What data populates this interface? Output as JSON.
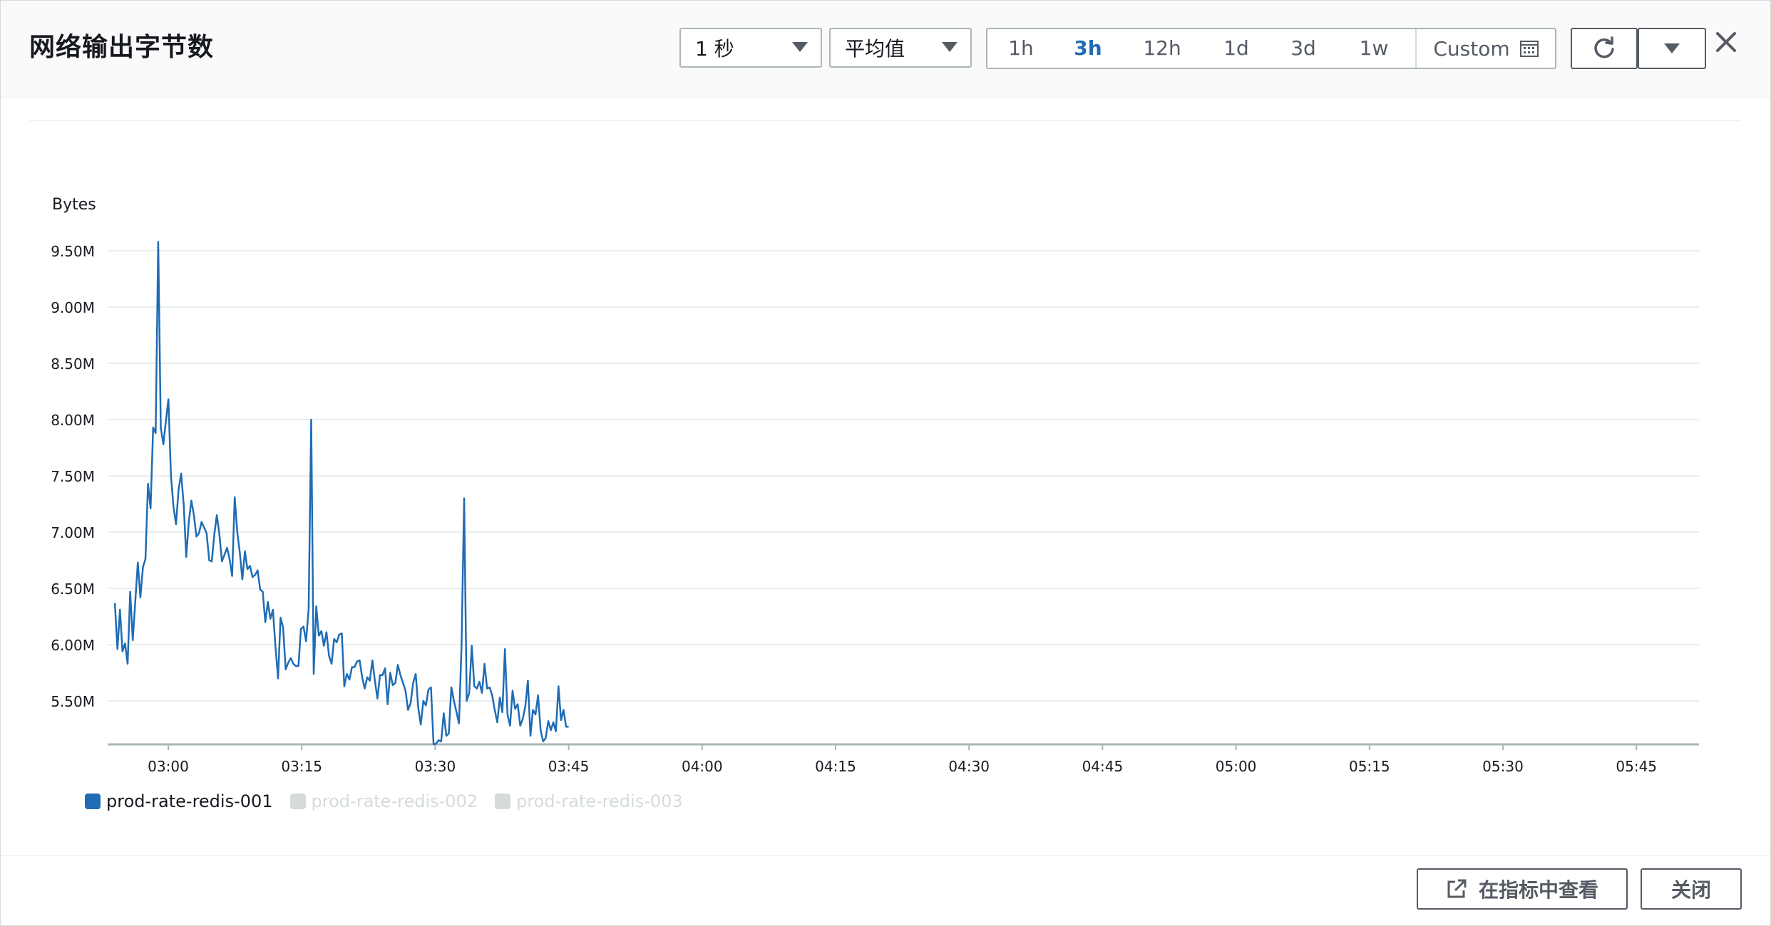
{
  "header": {
    "title": "网络输出字节数",
    "period_select": "1 秒",
    "stat_select": "平均值",
    "ranges": [
      "1h",
      "3h",
      "12h",
      "1d",
      "3d",
      "1w"
    ],
    "active_range": "3h",
    "custom_label": "Custom"
  },
  "footer": {
    "view_in_metrics": "在指标中查看",
    "close": "关闭"
  },
  "colors": {
    "series_primary": "#1f6cb5",
    "series_disabled": "#d5dbdb",
    "active_range": "#1f6cb5"
  },
  "icons": {
    "refresh": "refresh-icon",
    "dropdown": "chevron-down-icon",
    "close": "close-icon",
    "calendar": "calendar-icon",
    "external": "external-link-icon"
  },
  "chart_data": {
    "type": "line",
    "ylabel": "Bytes",
    "yticks": [
      "5.50M",
      "6.00M",
      "6.50M",
      "7.00M",
      "7.50M",
      "8.00M",
      "8.50M",
      "9.00M",
      "9.50M"
    ],
    "ylim": [
      5.2,
      9.65
    ],
    "xticks": [
      "03:00",
      "03:15",
      "03:30",
      "03:45",
      "04:00",
      "04:15",
      "04:30",
      "04:45",
      "05:00",
      "05:15",
      "05:30",
      "05:45"
    ],
    "x_range_minutes_from_0300": [
      -6,
      45
    ],
    "grid": true,
    "legend_position": "bottom-left",
    "series": [
      {
        "name": "prod-rate-redis-001",
        "enabled": true,
        "values": [
          6.37,
          5.96,
          6.31,
          5.94,
          6.01,
          5.83,
          6.47,
          6.04,
          6.38,
          6.73,
          6.42,
          6.69,
          6.76,
          7.43,
          7.21,
          7.93,
          7.88,
          9.58,
          7.93,
          7.78,
          7.98,
          8.18,
          7.5,
          7.22,
          7.07,
          7.38,
          7.52,
          7.24,
          6.78,
          7.09,
          7.28,
          7.15,
          6.96,
          6.99,
          7.09,
          7.04,
          6.99,
          6.75,
          6.74,
          6.98,
          7.15,
          6.98,
          6.74,
          6.8,
          6.86,
          6.76,
          6.61,
          7.31,
          7.0,
          6.82,
          6.58,
          6.83,
          6.67,
          6.7,
          6.6,
          6.62,
          6.66,
          6.49,
          6.47,
          6.2,
          6.38,
          6.23,
          6.31,
          5.98,
          5.7,
          6.24,
          6.15,
          5.78,
          5.84,
          5.88,
          5.83,
          5.81,
          5.81,
          6.14,
          6.16,
          6.03,
          6.32,
          8.0,
          5.74,
          6.34,
          6.08,
          6.12,
          5.99,
          6.11,
          5.9,
          5.83,
          6.05,
          6.02,
          6.09,
          6.1,
          5.63,
          5.74,
          5.69,
          5.8,
          5.8,
          5.85,
          5.86,
          5.71,
          5.61,
          5.71,
          5.68,
          5.86,
          5.68,
          5.52,
          5.73,
          5.73,
          5.79,
          5.47,
          5.75,
          5.64,
          5.66,
          5.82,
          5.73,
          5.66,
          5.59,
          5.42,
          5.48,
          5.66,
          5.74,
          5.44,
          5.29,
          5.5,
          5.46,
          5.6,
          5.62,
          5.11,
          5.12,
          5.15,
          5.14,
          5.39,
          5.19,
          5.21,
          5.62,
          5.5,
          5.4,
          5.3,
          6.0,
          7.3,
          5.5,
          5.57,
          5.99,
          5.63,
          5.61,
          5.67,
          5.57,
          5.83,
          5.61,
          5.62,
          5.55,
          5.42,
          5.31,
          5.53,
          5.4,
          5.96,
          5.38,
          5.28,
          5.59,
          5.43,
          5.47,
          5.28,
          5.34,
          5.45,
          5.68,
          5.19,
          5.42,
          5.38,
          5.55,
          5.24,
          5.14,
          5.17,
          5.32,
          5.24,
          5.31,
          5.23,
          5.63,
          5.33,
          5.42,
          5.27,
          5.27
        ]
      },
      {
        "name": "prod-rate-redis-002",
        "enabled": false,
        "values": []
      },
      {
        "name": "prod-rate-redis-003",
        "enabled": false,
        "values": []
      }
    ]
  }
}
